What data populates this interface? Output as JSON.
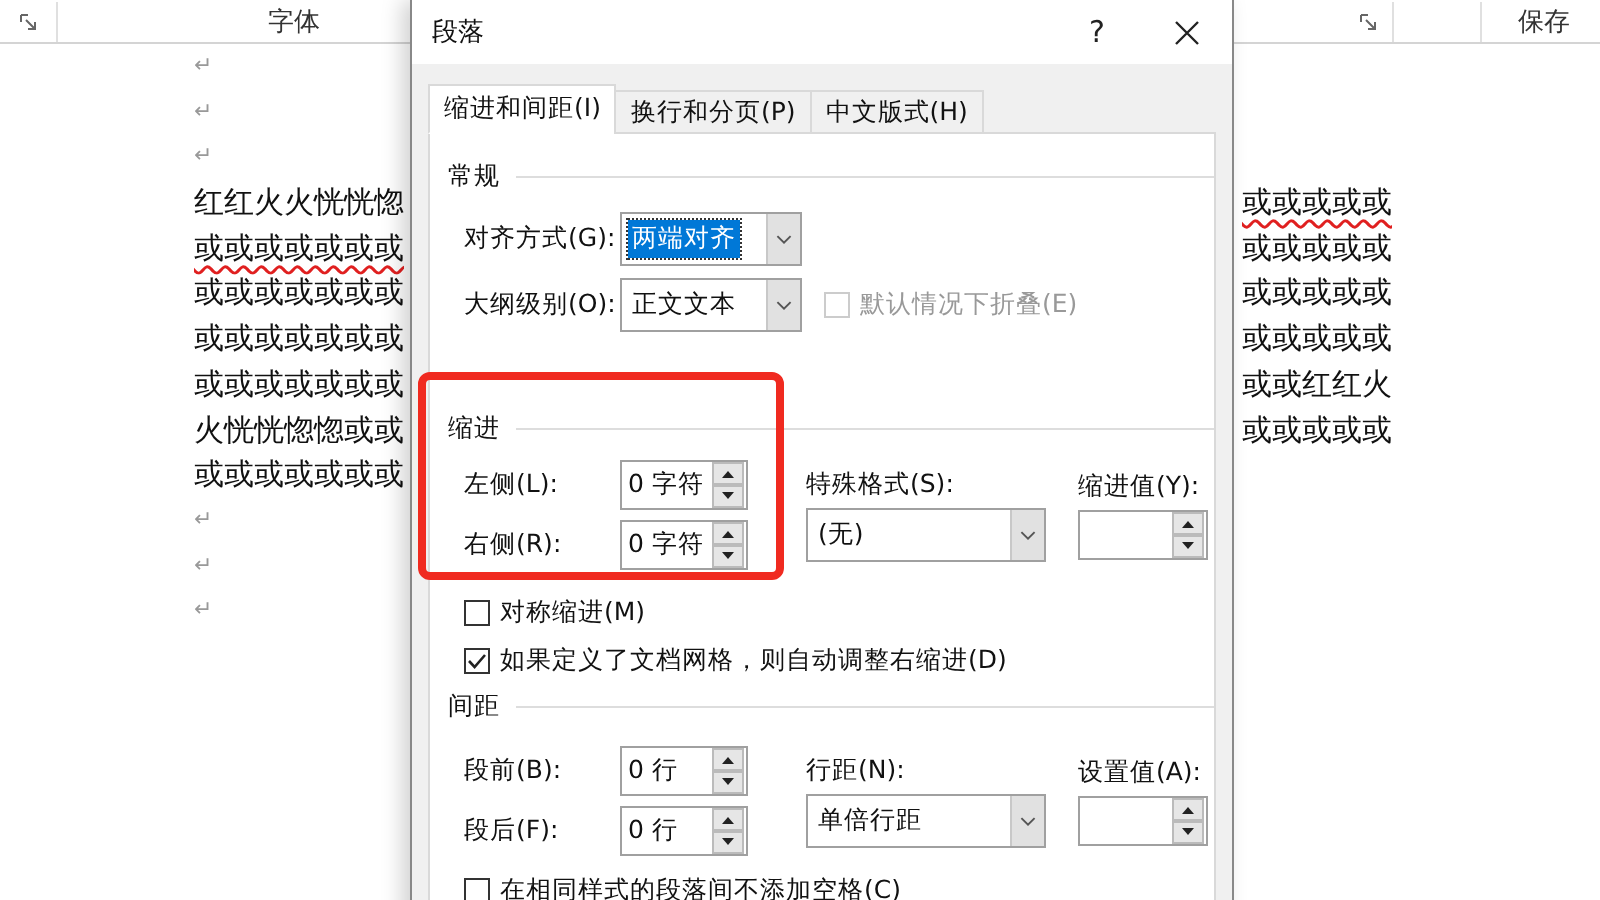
{
  "ribbon": {
    "groups": [
      {
        "label": "字体"
      },
      {
        "label": "保存"
      }
    ]
  },
  "document": {
    "lines": [
      {
        "kind": "mark",
        "text": "↵"
      },
      {
        "kind": "mark",
        "text": "↵"
      },
      {
        "kind": "mark",
        "text": "↵"
      },
      {
        "kind": "text",
        "left": "红红火火恍恍惚",
        "right": "或或或或或",
        "right_misspelled": true,
        "left_misspelled": false
      },
      {
        "kind": "text",
        "left": "或或或或或或或",
        "right": "或或或或或",
        "left_misspelled": true,
        "right_misspelled": false
      },
      {
        "kind": "text",
        "left": "或或或或或或或",
        "right": "或或或或或",
        "left_misspelled": false,
        "right_misspelled": false
      },
      {
        "kind": "text",
        "left": "或或或或或或或",
        "right": "或或或或或",
        "left_misspelled": false,
        "right_misspelled": false
      },
      {
        "kind": "text",
        "left": "或或或或或或或",
        "right": "或或红红火",
        "left_misspelled": false,
        "right_misspelled": false
      },
      {
        "kind": "text",
        "left": "火恍恍惚惚或或",
        "right": "或或或或或",
        "left_misspelled": false,
        "right_misspelled": false
      },
      {
        "kind": "text",
        "left": "或或或或或或或",
        "left_misspelled": false
      },
      {
        "kind": "mark",
        "text": "↵"
      },
      {
        "kind": "mark",
        "text": "↵"
      },
      {
        "kind": "mark",
        "text": "↵"
      }
    ]
  },
  "dialog": {
    "title": "段落",
    "help": "?",
    "tabs": [
      {
        "label": "缩进和间距(I)",
        "selected": true
      },
      {
        "label": "换行和分页(P)",
        "selected": false
      },
      {
        "label": "中文版式(H)",
        "selected": false
      }
    ],
    "general": {
      "heading": "常规",
      "alignment": {
        "label": "对齐方式(G):",
        "value": "两端对齐"
      },
      "outline_level": {
        "label": "大纲级别(O):",
        "value": "正文文本"
      },
      "collapse": {
        "label": "默认情况下折叠(E)",
        "checked": false,
        "disabled": true
      }
    },
    "indent": {
      "heading": "缩进",
      "highlighted": true,
      "left": {
        "label": "左侧(L):",
        "value": "0 字符"
      },
      "right": {
        "label": "右侧(R):",
        "value": "0 字符"
      },
      "special": {
        "label": "特殊格式(S):",
        "value": "(无)"
      },
      "by": {
        "label": "缩进值(Y):"
      },
      "mirror": {
        "label": "对称缩进(M)",
        "checked": false,
        "disabled": false
      },
      "auto_adjust": {
        "label": "如果定义了文档网格，则自动调整右缩进(D)",
        "checked": true,
        "disabled": false
      }
    },
    "spacing": {
      "heading": "间距",
      "before": {
        "label": "段前(B):",
        "value": "0 行"
      },
      "after": {
        "label": "段后(F):",
        "value": "0 行"
      },
      "line_spacing": {
        "label": "行距(N):",
        "value": "单倍行距"
      },
      "at": {
        "label": "设置值(A):"
      },
      "no_space": {
        "label": "在相同样式的段落间不添加空格(C)",
        "checked": false,
        "disabled": false
      }
    }
  }
}
